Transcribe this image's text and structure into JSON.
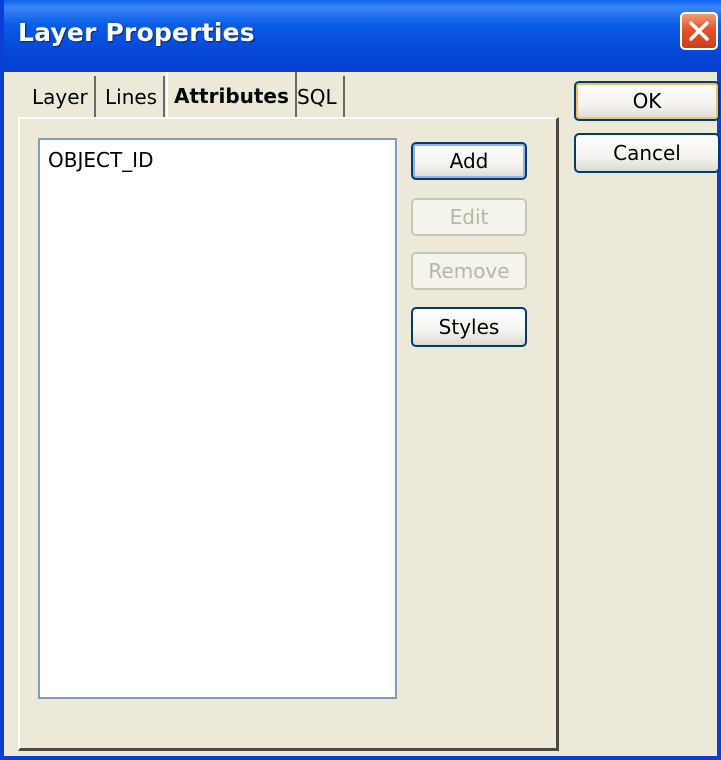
{
  "window": {
    "title": "Layer Properties"
  },
  "tabs": [
    {
      "label": "Layer",
      "active": false
    },
    {
      "label": "Lines",
      "active": false
    },
    {
      "label": "Attributes",
      "active": true
    },
    {
      "label": "SQL",
      "active": false
    }
  ],
  "attributes": {
    "items": [
      "OBJECT_ID"
    ],
    "buttons": {
      "add": "Add",
      "edit": "Edit",
      "remove": "Remove",
      "styles": "Styles"
    }
  },
  "dialog_buttons": {
    "ok": "OK",
    "cancel": "Cancel"
  },
  "colors": {
    "titlebar": "#0546d8",
    "close": "#e3542a",
    "face": "#ece9d8"
  },
  "icons": {
    "close": "close-icon"
  }
}
